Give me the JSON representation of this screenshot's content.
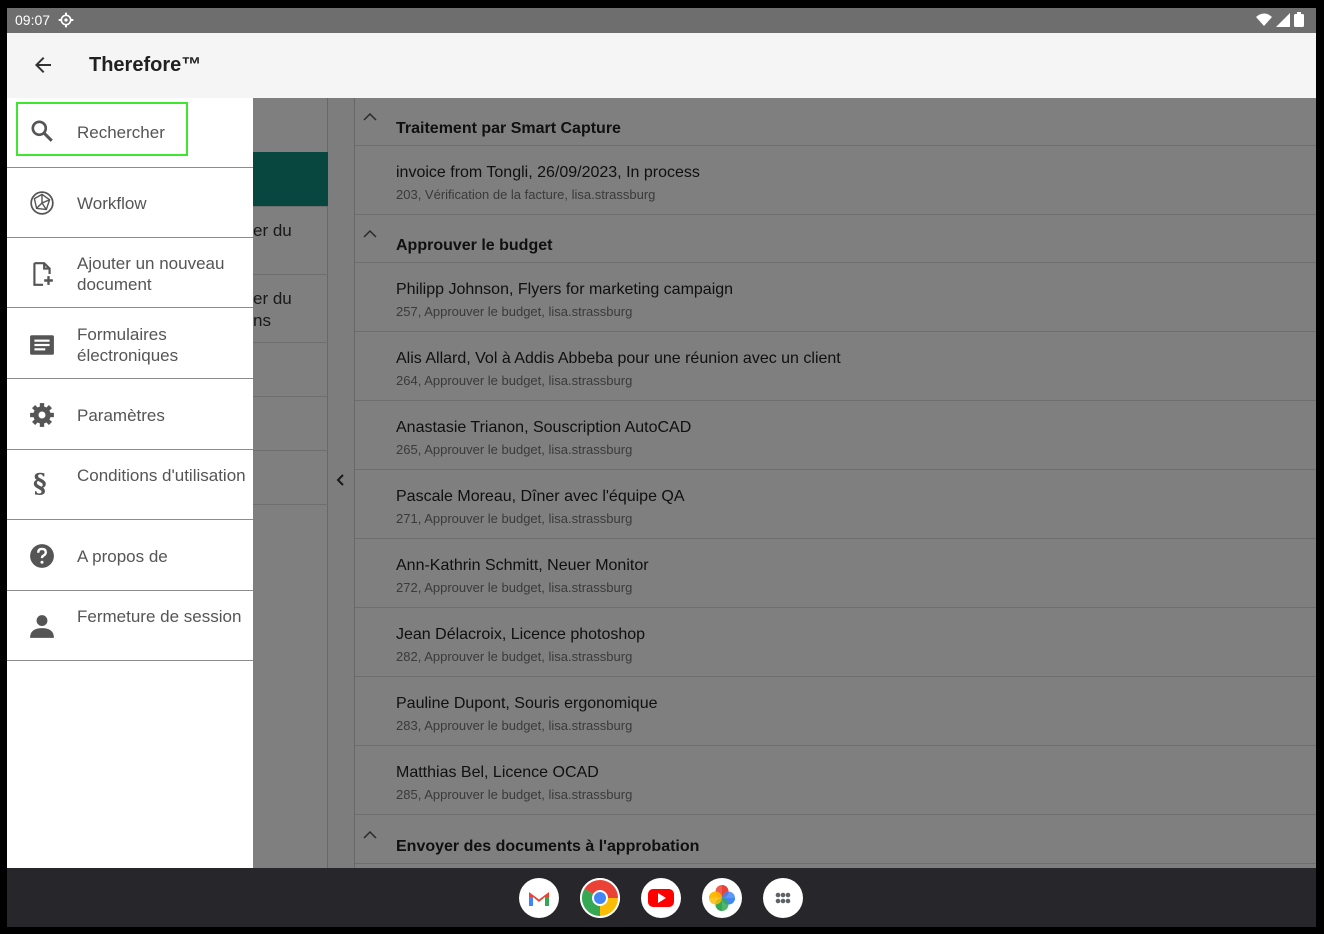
{
  "status_bar": {
    "time": "09:07"
  },
  "app_bar": {
    "title": "Therefore™"
  },
  "middle_panel": {
    "fragments": [
      "er du",
      "er du",
      "ns"
    ]
  },
  "groups": [
    {
      "title": "Traitement par Smart Capture",
      "items": [
        {
          "title": "invoice from Tongli, 26/09/2023, In process",
          "subtitle": "203, Vérification de la facture, lisa.strassburg"
        }
      ]
    },
    {
      "title": "Approuver le budget",
      "items": [
        {
          "title": "Philipp Johnson, Flyers for marketing campaign",
          "subtitle": "257, Approuver le budget, lisa.strassburg"
        },
        {
          "title": "Alis Allard, Vol à Addis Abbeba pour une réunion avec un client",
          "subtitle": "264, Approuver le budget, lisa.strassburg"
        },
        {
          "title": "Anastasie Trianon, Souscription AutoCAD",
          "subtitle": "265, Approuver le budget, lisa.strassburg"
        },
        {
          "title": "Pascale Moreau, Dîner avec l'équipe QA",
          "subtitle": "271, Approuver le budget, lisa.strassburg"
        },
        {
          "title": "Ann-Kathrin Schmitt, Neuer Monitor",
          "subtitle": "272, Approuver le budget, lisa.strassburg"
        },
        {
          "title": "Jean Délacroix, Licence photoshop",
          "subtitle": "282, Approuver le budget, lisa.strassburg"
        },
        {
          "title": "Pauline Dupont, Souris ergonomique",
          "subtitle": "283, Approuver le budget, lisa.strassburg"
        },
        {
          "title": "Matthias Bel, Licence OCAD",
          "subtitle": "285, Approuver le budget, lisa.strassburg"
        }
      ]
    },
    {
      "title": "Envoyer des documents à l'approbation",
      "items": []
    }
  ],
  "drawer": {
    "search_label": "Rechercher",
    "items": [
      {
        "icon": "workflow-icon",
        "label": "Workflow"
      },
      {
        "icon": "add-document-icon",
        "label": "Ajouter un nouveau document"
      },
      {
        "icon": "forms-icon",
        "label": "Formulaires électroniques"
      },
      {
        "icon": "settings-icon",
        "label": "Paramètres"
      },
      {
        "icon": "section-icon",
        "label": "Conditions d'utilisation"
      },
      {
        "icon": "help-icon",
        "label": "A propos de"
      },
      {
        "icon": "person-icon",
        "label": "Fermeture de session"
      }
    ]
  },
  "dock": [
    "gmail-icon",
    "chrome-icon",
    "youtube-icon",
    "photos-icon",
    "app-drawer-icon"
  ],
  "colors": {
    "accent": "#0e8f7e",
    "highlight": "#3ee62e",
    "status_bar": "#6e6e6e",
    "nav_bar": "#27272b"
  }
}
